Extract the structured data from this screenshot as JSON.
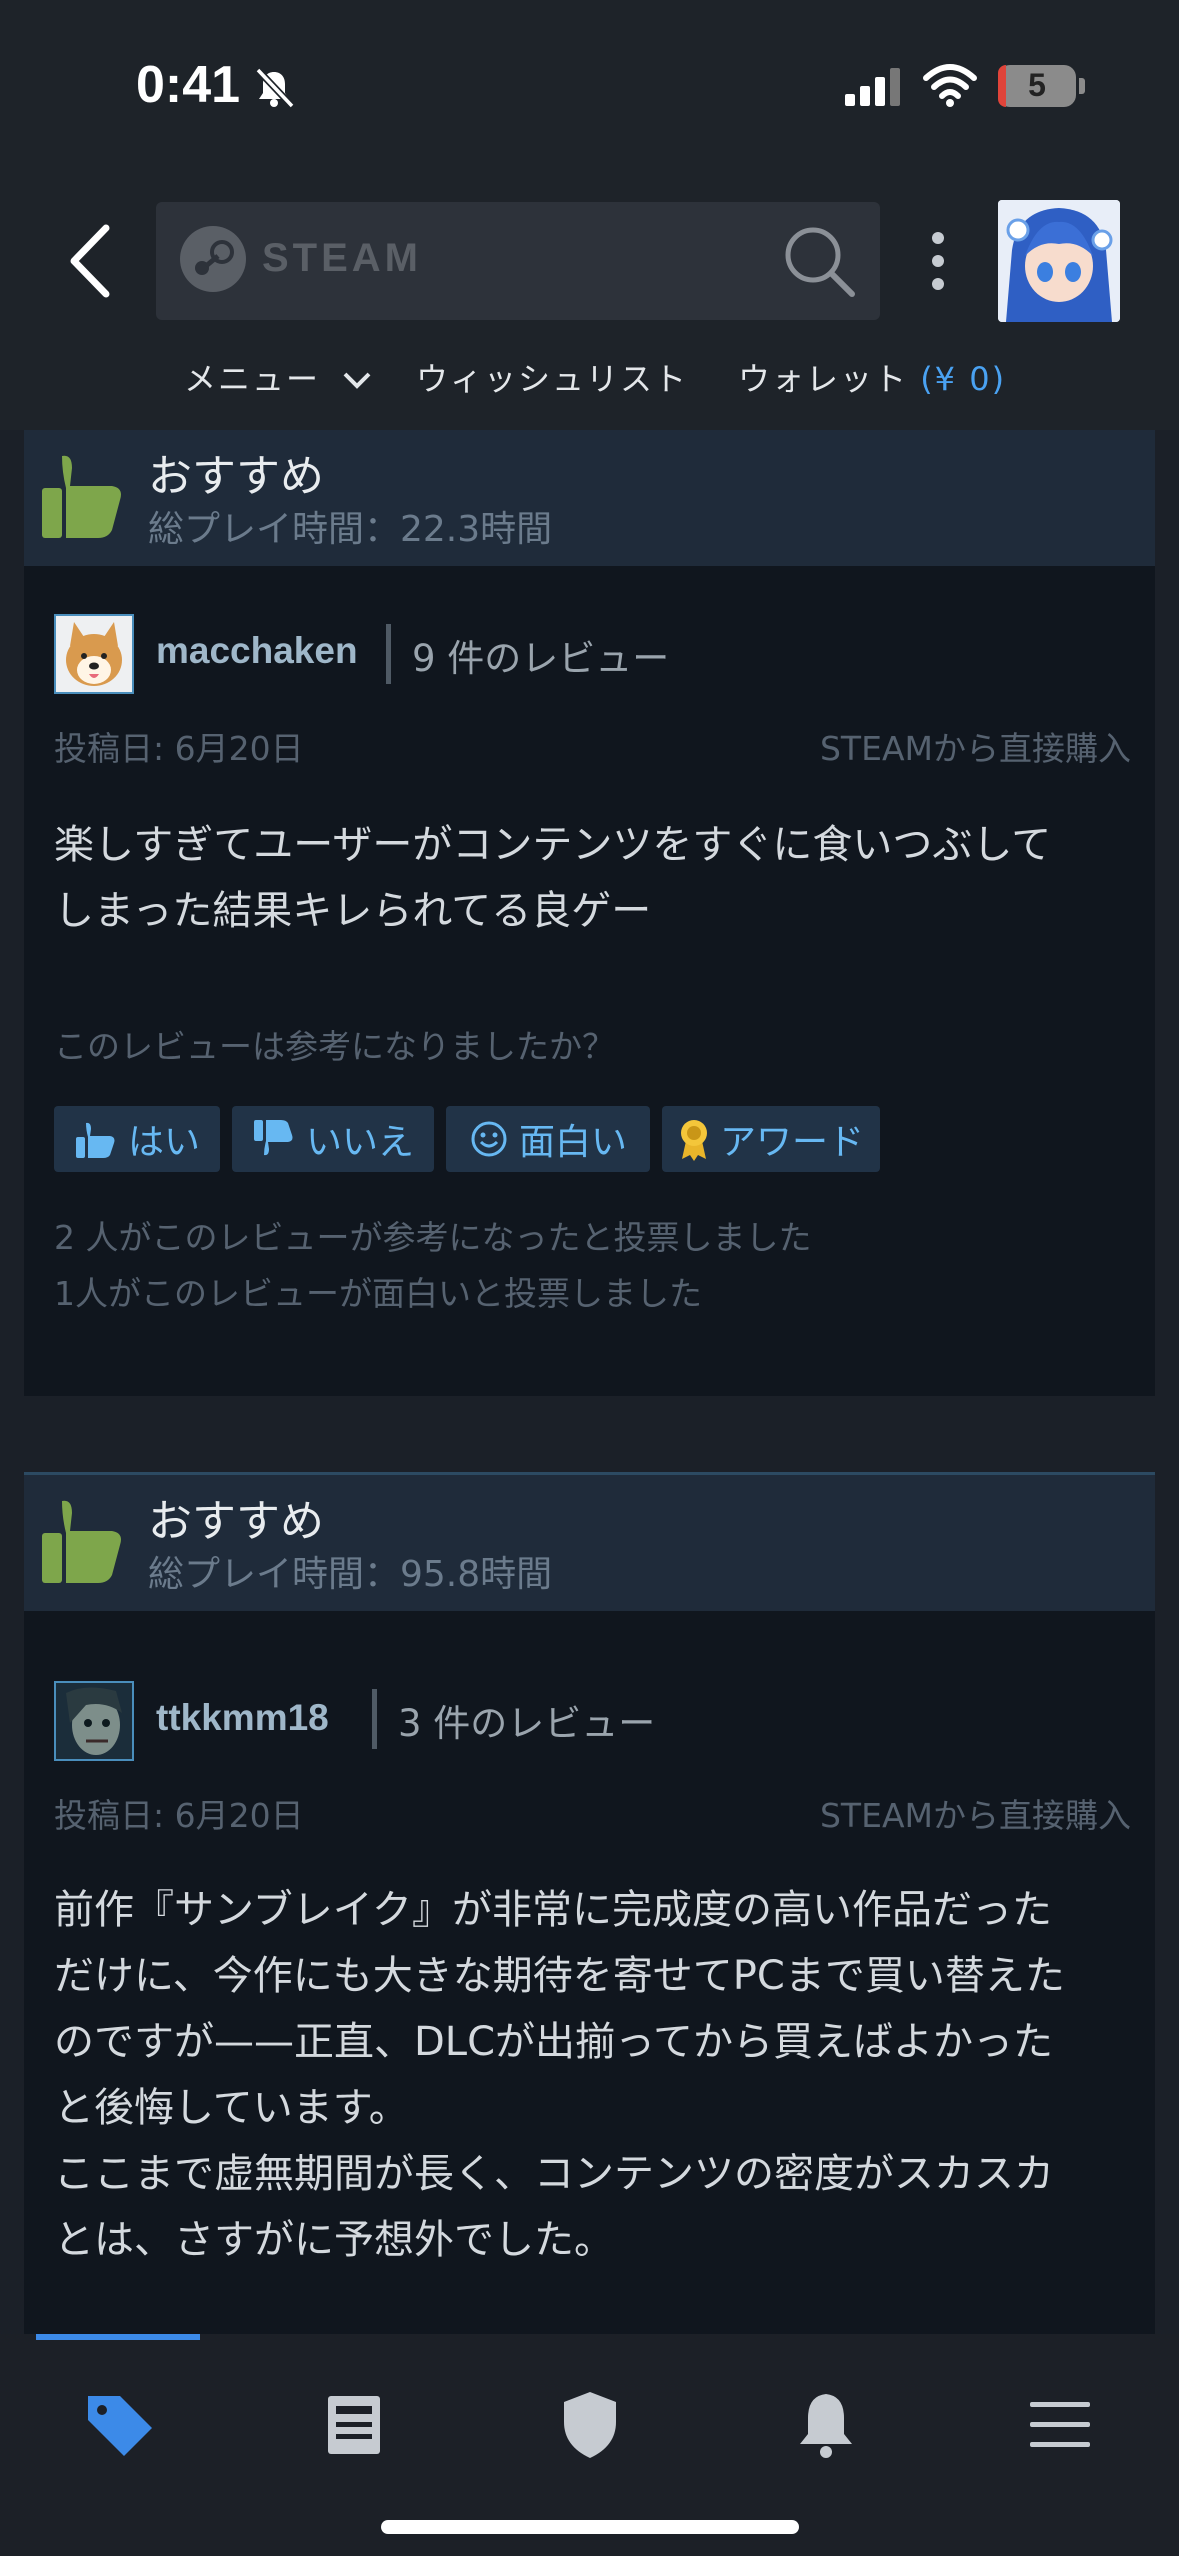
{
  "status_bar": {
    "time": "0:41",
    "battery": "5"
  },
  "header": {
    "search_brand": "STEAM",
    "nav": {
      "menu": "メニュー",
      "wishlist": "ウィッシュリスト",
      "wallet": "ウォレット",
      "wallet_amount": "(¥ 0)"
    }
  },
  "reviews": [
    {
      "recommendation": "おすすめ",
      "playtime": "総プレイ時間：22.3時間",
      "username": "macchaken",
      "review_count": "9 件のレビュー",
      "posted": "投稿日: 6月20日",
      "source": "STEAMから直接購入",
      "body_lines": [
        "楽しすぎてユーザーがコンテンツをすぐに食いつぶして",
        "しまった結果キレられてる良ゲー"
      ],
      "helpful_question": "このレビューは参考になりましたか？",
      "buttons": {
        "yes": "はい",
        "no": "いいえ",
        "funny": "面白い",
        "award": "アワード"
      },
      "vote_helpful": "2 人がこのレビューが参考になったと投票しました",
      "vote_funny": "1人がこのレビューが面白いと投票しました"
    },
    {
      "recommendation": "おすすめ",
      "playtime": "総プレイ時間：95.8時間",
      "username": "ttkkmm18",
      "review_count": "3 件のレビュー",
      "posted": "投稿日: 6月20日",
      "source": "STEAMから直接購入",
      "body_lines": [
        "前作『サンブレイク』が非常に完成度の高い作品だった",
        "だけに、今作にも大きな期待を寄せてPCまで買い替えた",
        "のですが——正直、DLCが出揃ってから買えばよかった",
        "と後悔しています。",
        "ここまで虚無期間が長く、コンテンツの密度がスカスカ",
        "とは、さすがに予想外でした。"
      ]
    }
  ],
  "colors": {
    "accent": "#3c8ae8",
    "link": "#67b8f2",
    "thumb_green": "#7ea64b",
    "card_bg": "#10161e",
    "card_head": "#1f2b3a"
  },
  "icons": [
    "back-icon",
    "steam-logo-icon",
    "search-icon",
    "more-icon",
    "thumbs-up-icon",
    "tag-icon",
    "news-icon",
    "shield-icon",
    "bell-icon",
    "hamburger-icon"
  ]
}
